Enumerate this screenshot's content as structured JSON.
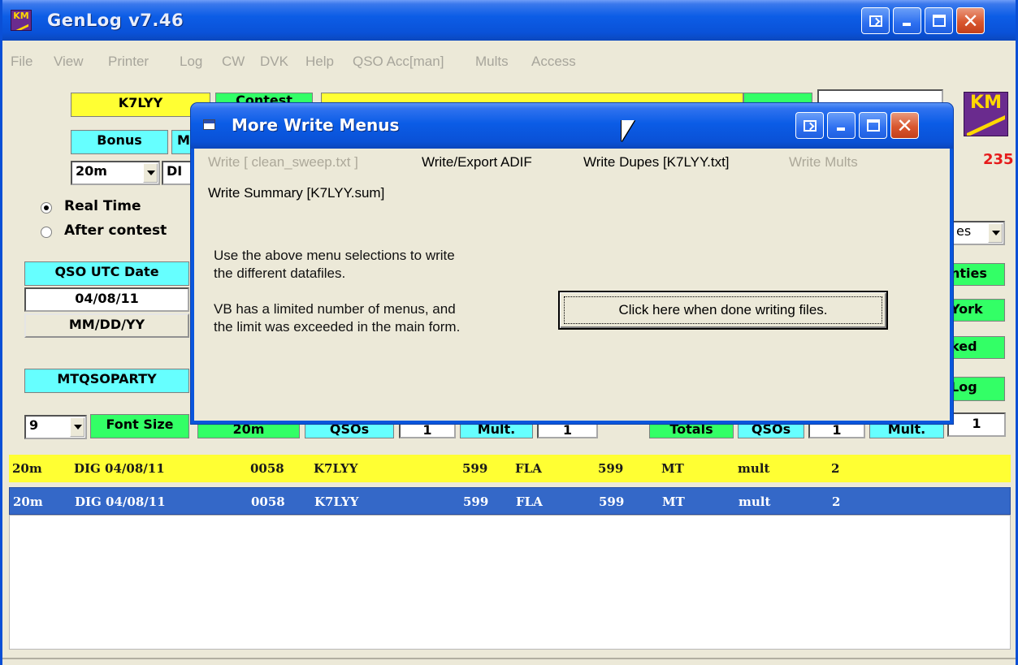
{
  "window": {
    "title": "GenLog  v7.46",
    "menus": [
      "File",
      "View",
      "Printer",
      "Log",
      "CW",
      "DVK",
      "Help",
      "QSO Acc[man]",
      "Mults",
      "Access"
    ]
  },
  "header_fields": {
    "callsign": "K7LYY",
    "contest_partial": "Contest",
    "count": "235",
    "bonus_label": "Bonus",
    "m_partial": "M",
    "band": "20m",
    "mode_partial": "DI"
  },
  "timing": {
    "real_time": "Real Time",
    "after_contest": "After contest",
    "selected": "real_time"
  },
  "date": {
    "label": "QSO UTC Date",
    "value": "04/08/11",
    "format": "MM/DD/YY"
  },
  "contest_name": "MTQSOPARTY",
  "font": {
    "size": "9",
    "label": "Font Size"
  },
  "stats_row": {
    "band": "20m",
    "qsos_label": "QSOs",
    "qsos_value": "1",
    "mult_label": "Mult.",
    "mult_value": "1",
    "totals_label": "Totals",
    "total_qsos_label": "QSOs",
    "total_qsos_value": "1",
    "total_mult_label": "Mult.",
    "total_mult_value": "1"
  },
  "right_partial": {
    "combo": "es",
    "counties": "nties",
    "york": "York",
    "checked": "ked",
    "log": "Log"
  },
  "log_entry": {
    "band": "20m",
    "mode_date": "DIG 04/08/11",
    "time": "0058",
    "call": "K7LYY",
    "rst_sent": "599",
    "exch_sent": "FLA",
    "rst_rcvd": "599",
    "exch_rcvd": "MT",
    "mult": "mult",
    "num": "2"
  },
  "dialog": {
    "title": "More Write Menus",
    "menu": {
      "write_clean": "Write [ clean_sweep.txt ]",
      "write_adif": "Write/Export ADIF",
      "write_dupes": "Write Dupes [K7LYY.txt]",
      "write_mults": "Write Mults",
      "write_summary": "Write Summary [K7LYY.sum]"
    },
    "text1_line1": "Use the above menu selections to write",
    "text1_line2": "the different datafiles.",
    "text2_line1": "VB has a limited number of menus, and",
    "text2_line2": "the limit was exceeded in the main form.",
    "done_button": "Click here when done writing files."
  },
  "colors": {
    "titlebar": "#0a52d8",
    "yellow": "#ffff33",
    "cyan": "#66ffff",
    "green": "#33ff66",
    "selection": "#3468c8",
    "count": "#e61b1b"
  }
}
